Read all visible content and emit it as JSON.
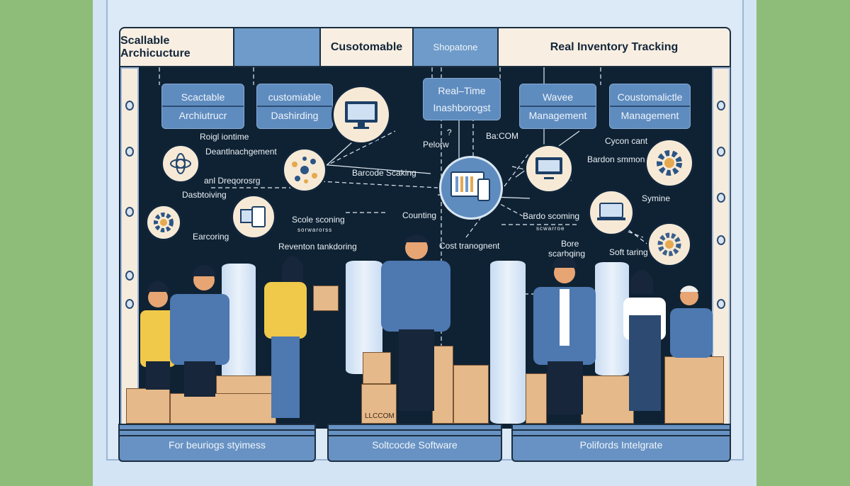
{
  "banner": [
    "Scallable Archicucture",
    "",
    "Cusotomable",
    "Shopatone",
    "Real Inventory Tracking"
  ],
  "cards": [
    {
      "line1": "Scactable",
      "line2": "Archiutrucr"
    },
    {
      "line1": "customiable",
      "line2": "Dashirding"
    },
    {
      "line1": "Real–Time",
      "line2": "Inashborogst"
    },
    {
      "line1": "Wavee",
      "line2": "Management"
    },
    {
      "line1": "Coustomalictle",
      "line2": "Management"
    }
  ],
  "labels": {
    "roigl": "Roigl iontime",
    "deant": "Deantlnachgement",
    "and": "anl Dreqorosrg",
    "dasbo": "Dasbtoiving",
    "earcoring": "Earcoring",
    "barcode": "Barcode Scaking",
    "question": "?",
    "pelorw": "Pelorw",
    "bacom": "Ba:COM",
    "scale": "Scole sconing",
    "scale_sub": "sorwarorss",
    "reventon": "Reventon tankdoring",
    "counting": "Counting",
    "cost": "Cost tranognent",
    "cycon": "Cycon cant",
    "bardon": "Bardon smmon",
    "symine": "Symine",
    "bardo": "Bardo scoming",
    "bardo_sub": "scwarroe",
    "bore1": "Bore",
    "bore2": "scarbging",
    "soft": "Soft taring"
  },
  "box_stamp": "LLCCOM",
  "platforms": [
    "For beuriogs styimess",
    "Soltcocde Software",
    "Polifords Intelgrate"
  ],
  "colors": {
    "background": "#8dbd78",
    "panel": "#d3e4f5",
    "board": "#0f2233",
    "accent": "#5f8cbf",
    "cream": "#f6ead6",
    "box": "#e6b98a"
  }
}
